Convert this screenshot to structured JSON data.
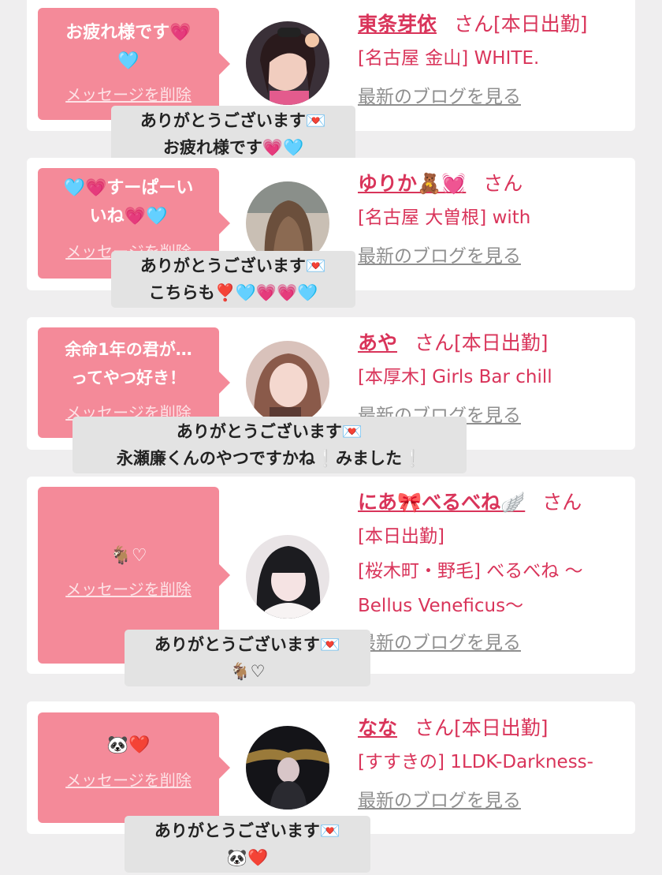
{
  "cards": [
    {
      "message": "お疲れ様です💗\n🩵",
      "delete_label": "メッセージを削除",
      "name": "東条芽依",
      "san_label": "さん[本日出勤]",
      "shop_lines": [
        "[名古屋 金山] WHITE."
      ],
      "blog_label": "最新のブログを見る",
      "reply": "ありがとうございます💌\nお疲れ様です💗🩵"
    },
    {
      "message": "🩵💗すーぱーい\nいね💗🩵",
      "delete_label": "メッセージを削除",
      "name": "ゆりか🧸💓",
      "san_label": "さん",
      "shop_lines": [
        "[名古屋 大曽根] with"
      ],
      "blog_label": "最新のブログを見る",
      "reply": "ありがとうございます💌\nこちらも❣️🩵💗💗🩵"
    },
    {
      "message": "余命1年の君が…\nってやつ好き！",
      "delete_label": "メッセージを削除",
      "name": "あや",
      "san_label": "さん[本日出勤]",
      "shop_lines": [
        "[本厚木] Girls Bar chill"
      ],
      "blog_label": "最新のブログを見る",
      "reply": "ありがとうございます💌\n永瀬廉くんのやつですかね❕みました❕"
    },
    {
      "message": "🐐♡",
      "delete_label": "メッセージを削除",
      "name": "にあ🎀べるべね🪽",
      "san_label": "さん",
      "shop_lines": [
        "[本日出勤]",
        "[桜木町・野毛] べるべね 〜",
        "Bellus Veneficus〜"
      ],
      "blog_label": "最新のブログを見る",
      "reply": "ありがとうございます💌\n🐐♡"
    },
    {
      "message": "🐼❤️",
      "delete_label": "メッセージを削除",
      "name": "なな",
      "san_label": "さん[本日出勤]",
      "shop_lines": [
        "[すすきの] 1LDK-Darkness-"
      ],
      "blog_label": "最新のブログを見る",
      "reply": "ありがとうございます💌\n🐼❤️"
    }
  ],
  "colors": {
    "background": "#efeeef",
    "bubble": "#f48a99",
    "accent": "#d9345a",
    "link_gray": "#8f8f8f",
    "reply_bg": "#e3e3e3"
  }
}
